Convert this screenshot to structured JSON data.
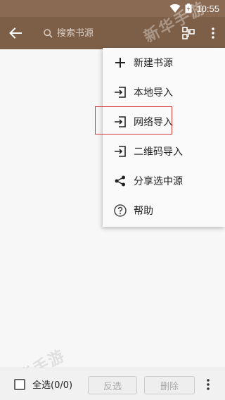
{
  "status_bar": {
    "time": "10:55"
  },
  "toolbar": {
    "search_placeholder": "搜索书源"
  },
  "menu": {
    "items": [
      {
        "label": "新建书源",
        "icon": "plus-icon"
      },
      {
        "label": "本地导入",
        "icon": "import-icon"
      },
      {
        "label": "网络导入",
        "icon": "import-icon"
      },
      {
        "label": "二维码导入",
        "icon": "import-icon"
      },
      {
        "label": "分享选中源",
        "icon": "share-icon"
      },
      {
        "label": "帮助",
        "icon": "help-icon"
      }
    ]
  },
  "bottom_bar": {
    "select_all_label": "全选(0/0)",
    "invert_label": "反选",
    "delete_label": "删除"
  },
  "watermark": {
    "text": "新华手游"
  },
  "colors": {
    "toolbar": "#7d5f48",
    "status_bar": "#8a6a52",
    "highlight": "#d03a3a"
  }
}
